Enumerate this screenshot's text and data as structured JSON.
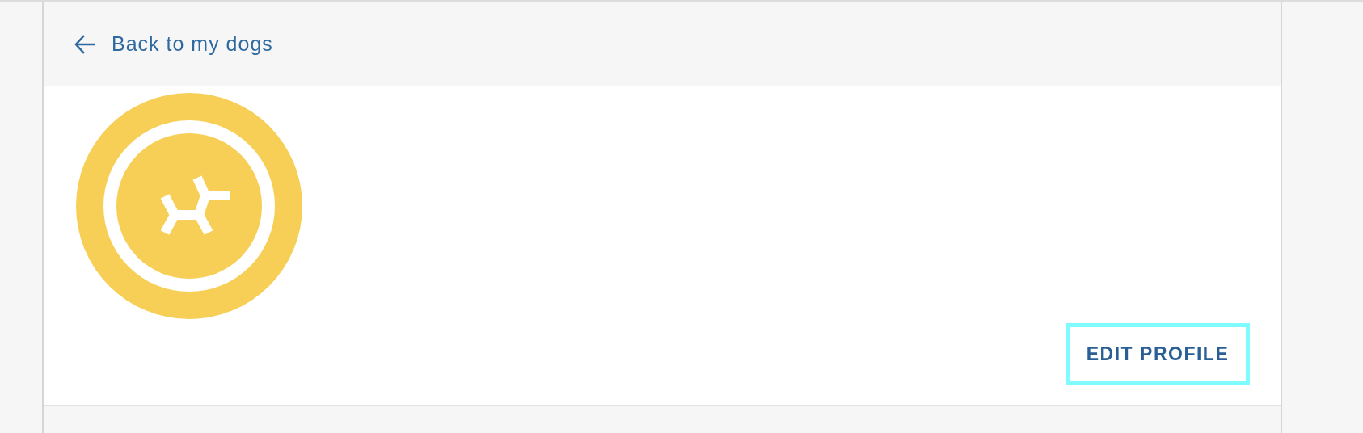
{
  "back_link": {
    "label": "Back to my dogs"
  },
  "edit_button": {
    "label": "EDIT PROFILE"
  }
}
